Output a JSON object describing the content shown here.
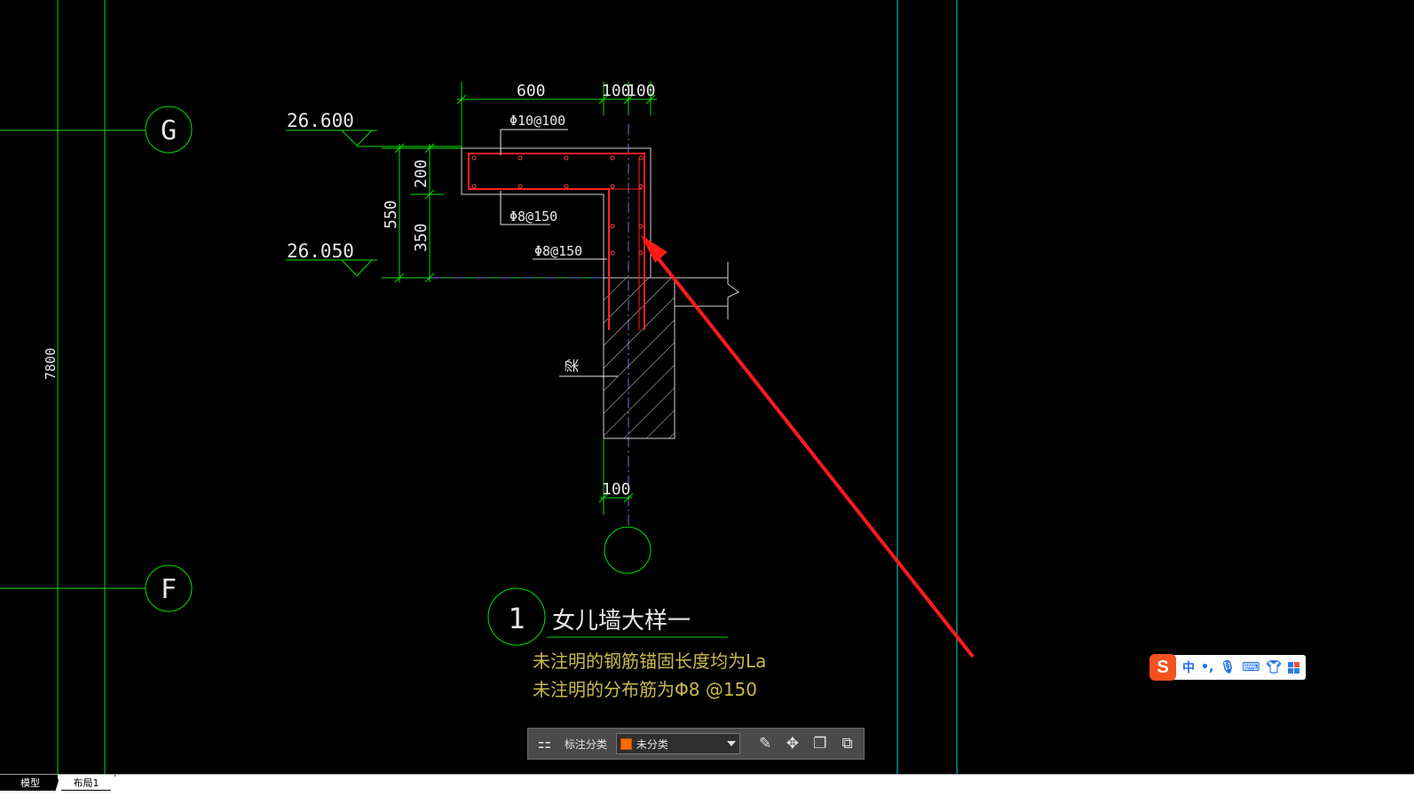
{
  "drawing": {
    "axis_g": "G",
    "axis_f": "F",
    "span_dim": "7800",
    "elev_top": "26.600",
    "elev_bottom": "26.050",
    "dim_600": "600",
    "dim_100_left": "100",
    "dim_100_right": "100",
    "rebar_top": "Φ10@100",
    "rebar_dist": "Φ8@150",
    "rebar_wall": "Φ8@150",
    "dim_550": "550",
    "dim_200": "200",
    "dim_350": "350",
    "beam_label": "梁",
    "dim_bottom_100": "100",
    "detail_number": "1",
    "detail_title": "女儿墙大样一",
    "note_1": "未注明的钢筋锚固长度均为La",
    "note_2": "未注明的分布筋为Φ8 @150"
  },
  "toolbar": {
    "category_label": "标注分类",
    "category_value": "未分类",
    "swatch_color": "#ff6a00"
  },
  "ime": {
    "mode": "中",
    "punct": "•,"
  },
  "tabs": [
    {
      "label": "模型",
      "active": true
    },
    {
      "label": "布局1",
      "active": false
    }
  ]
}
